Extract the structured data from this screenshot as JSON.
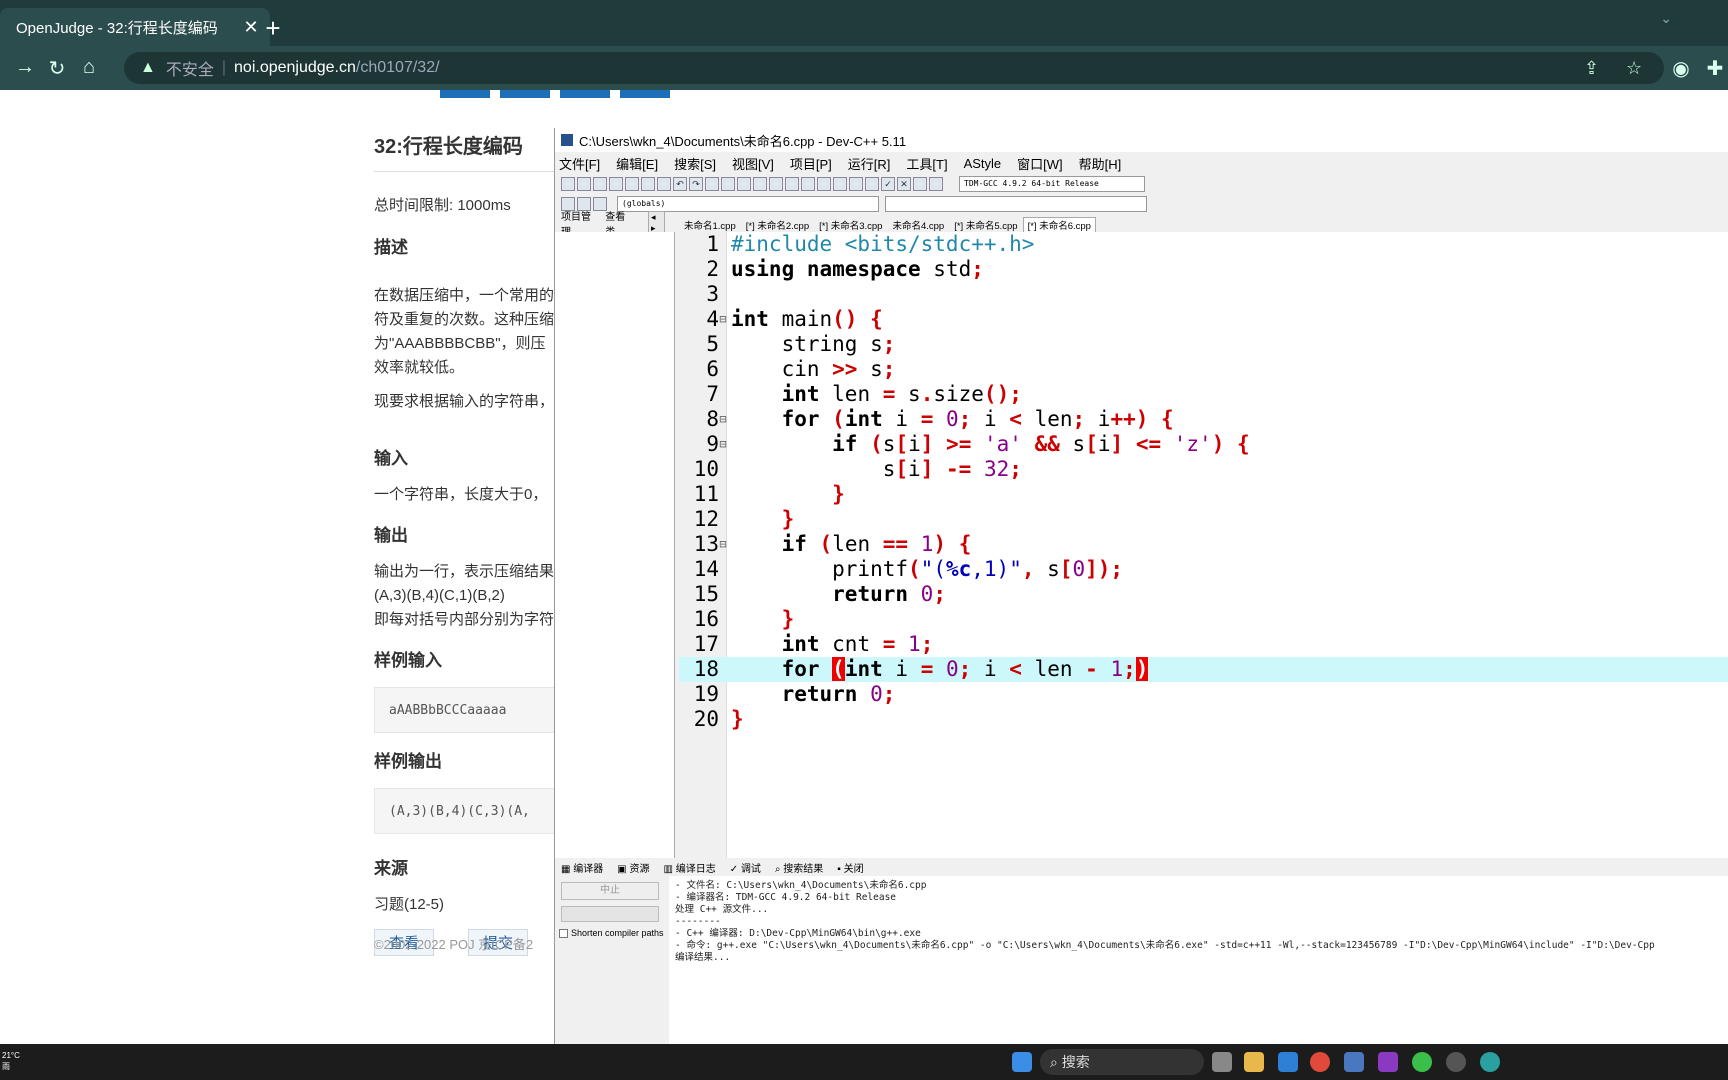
{
  "browser": {
    "tab_title": "OpenJudge - 32:行程长度编码",
    "insecure_label": "不安全",
    "url_host": "noi.openjudge.cn",
    "url_path": "/ch0107/32/"
  },
  "problem": {
    "title": "32:行程长度编码",
    "time_limit": "总时间限制: 1000ms",
    "desc_heading": "描述",
    "desc_p1_l1": "在数据压缩中，一个常用的",
    "desc_p1_l2": "符及重复的次数。这种压缩",
    "desc_p1_l3": "为\"AAABBBBCBB\"，则压",
    "desc_p1_l4": "效率就较低。",
    "desc_p2": "现要求根据输入的字符串，",
    "input_heading": "输入",
    "input_text": "一个字符串，长度大于0，",
    "output_heading": "输出",
    "output_l1": "输出为一行，表示压缩结果",
    "output_l2": "(A,3)(B,4)(C,1)(B,2)",
    "output_l3": "即每对括号内部分别为字符",
    "sample_in_heading": "样例输入",
    "sample_in": "aAABBbBCCCaaaaa",
    "sample_out_heading": "样例输出",
    "sample_out": "(A,3)(B,4)(C,3)(A,",
    "source_heading": "来源",
    "source_text": "习题(12-5)",
    "view_btn": "查看",
    "submit_btn": "提交",
    "copyright": "©2002-2022 POJ 京ICP备2"
  },
  "ide": {
    "title": "C:\\Users\\wkn_4\\Documents\\未命名6.cpp - Dev-C++ 5.11",
    "menu": [
      "文件[F]",
      "编辑[E]",
      "搜索[S]",
      "视图[V]",
      "项目[P]",
      "运行[R]",
      "工具[T]",
      "AStyle",
      "窗口[W]",
      "帮助[H]"
    ],
    "compiler": "TDM-GCC 4.9.2 64-bit Release",
    "scope": "(globals)",
    "side_tabs": [
      "项目管理",
      "查看类"
    ],
    "file_tabs": [
      "未命名1.cpp",
      "[*] 未命名2.cpp",
      "[*] 未命名3.cpp",
      "未命名4.cpp",
      "[*] 未命名5.cpp",
      "[*] 未命名6.cpp"
    ],
    "bottom_tabs": [
      "编译器",
      "资源",
      "编译日志",
      "调试",
      "搜索结果",
      "关闭"
    ],
    "stop_btn": "中止",
    "shorten_paths": "Shorten compiler paths",
    "log_lines": [
      "- 文件名: C:\\Users\\wkn_4\\Documents\\未命名6.cpp",
      "- 编译器名: TDM-GCC 4.9.2 64-bit Release",
      "",
      "处理 C++ 源文件...",
      "--------",
      "- C++ 编译器: D:\\Dev-Cpp\\MinGW64\\bin\\g++.exe",
      "- 命令: g++.exe \"C:\\Users\\wkn_4\\Documents\\未命名6.cpp\" -o \"C:\\Users\\wkn_4\\Documents\\未命名6.exe\" -std=c++11 -Wl,--stack=123456789 -I\"D:\\Dev-Cpp\\MinGW64\\include\" -I\"D:\\Dev-Cpp",
      "",
      "编译结果..."
    ]
  },
  "taskbar": {
    "weather_temp": "21°C",
    "weather_desc": "雨",
    "search": "搜索"
  }
}
